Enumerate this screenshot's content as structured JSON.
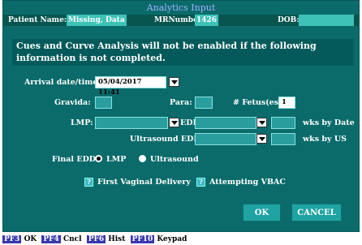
{
  "window": {
    "title": "Analytics Input"
  },
  "patient": {
    "name_label": "Patient Name:",
    "name_value": "Missing, Data",
    "mrn_label": "MRNumber:",
    "mrn_value": "1426",
    "dob_label": "DOB:",
    "dob_value": ""
  },
  "notice": "Cues and Curve Analysis will not be enabled if the following information is not completed.",
  "arrival": {
    "label": "Arrival date/time:",
    "value": "05/04/2017 11:41"
  },
  "gravida": {
    "label": "Gravida:",
    "value": ""
  },
  "para": {
    "label": "Para:",
    "value": ""
  },
  "fetus": {
    "label": "# Fetus(es):",
    "value": "1"
  },
  "lmp": {
    "label": "LMP:",
    "value": ""
  },
  "edd": {
    "label": "EDD:",
    "value": "",
    "wks_value": "",
    "wks_label": "wks by Date"
  },
  "us_edd": {
    "label": "Ultrasound EDD:",
    "value": "",
    "wks_value": "",
    "wks_label": "wks by US"
  },
  "final_edd": {
    "label": "Final EDD",
    "options": [
      "LMP",
      "Ultrasound"
    ],
    "selected": "LMP"
  },
  "checkboxes": {
    "first_vaginal": "First Vaginal Delivery",
    "vbac": "Attempting VBAC",
    "mark": "?"
  },
  "buttons": {
    "ok": "OK",
    "cancel": "CANCEL"
  },
  "fkeys": [
    {
      "key": "PF3",
      "label": "OK"
    },
    {
      "key": "PF4",
      "label": "Cncl"
    },
    {
      "key": "PF6",
      "label": "Hist"
    },
    {
      "key": "PF10",
      "label": "Keypad"
    }
  ],
  "colors": {
    "frame": "#0b6b6b",
    "title_text": "#9fb0ff",
    "fkey_bg": "#3a37b0"
  }
}
